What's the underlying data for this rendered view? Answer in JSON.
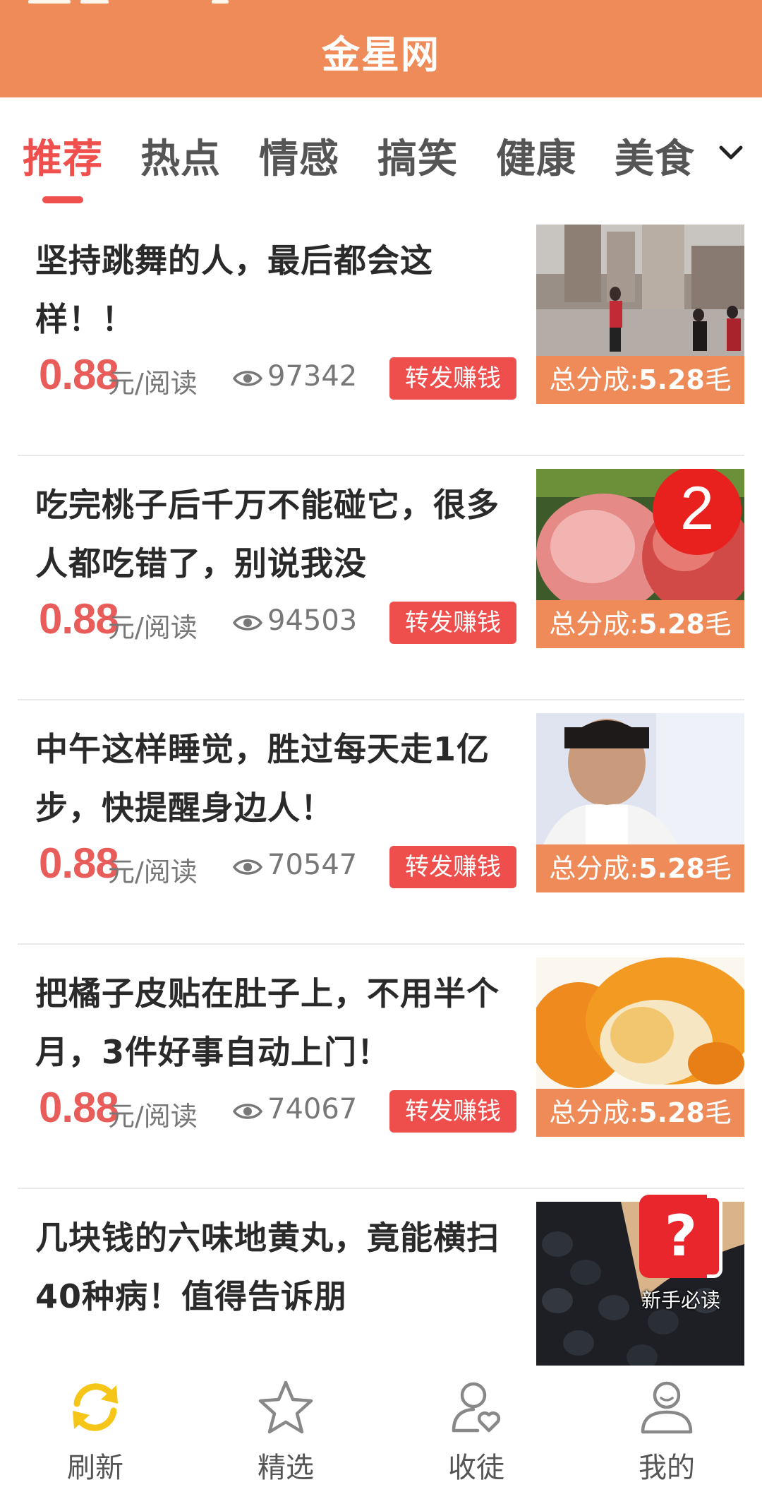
{
  "header": {
    "title": "金星网"
  },
  "tabs": {
    "items": [
      {
        "label": "推荐",
        "active": true
      },
      {
        "label": "热点",
        "active": false
      },
      {
        "label": "情感",
        "active": false
      },
      {
        "label": "搞笑",
        "active": false
      },
      {
        "label": "健康",
        "active": false
      },
      {
        "label": "美食",
        "active": false
      }
    ],
    "more_icon": "chevron-down-icon"
  },
  "articles": [
    {
      "title": "坚持跳舞的人，最后都会这样！！",
      "price": "0.88",
      "price_unit": "元/阅读",
      "views": "97342",
      "share_label": "转发赚钱",
      "badge_prefix": "总分成:",
      "badge_value": "5.28",
      "badge_unit": "毛"
    },
    {
      "title": "吃完桃子后千万不能碰它，很多人都吃错了，别说我没",
      "price": "0.88",
      "price_unit": "元/阅读",
      "views": "94503",
      "share_label": "转发赚钱",
      "badge_prefix": "总分成:",
      "badge_value": "5.28",
      "badge_unit": "毛",
      "image_number": "2"
    },
    {
      "title": "中午这样睡觉，胜过每天走1亿步，快提醒身边人！",
      "price": "0.88",
      "price_unit": "元/阅读",
      "views": "70547",
      "share_label": "转发赚钱",
      "badge_prefix": "总分成:",
      "badge_value": "5.28",
      "badge_unit": "毛"
    },
    {
      "title": "把橘子皮贴在肚子上，不用半个月，3件好事自动上门！",
      "price": "0.88",
      "price_unit": "元/阅读",
      "views": "74067",
      "share_label": "转发赚钱",
      "badge_prefix": "总分成:",
      "badge_value": "5.28",
      "badge_unit": "毛"
    },
    {
      "title": "几块钱的六味地黄丸，竟能横扫40种病！值得告诉朋"
    }
  ],
  "newbie": {
    "icon": "question-icon",
    "label": "新手必读"
  },
  "bottom_nav": [
    {
      "label": "刷新",
      "icon": "refresh-icon",
      "color": "#f5c518"
    },
    {
      "label": "精选",
      "icon": "star-icon"
    },
    {
      "label": "收徒",
      "icon": "disciple-icon"
    },
    {
      "label": "我的",
      "icon": "profile-icon"
    }
  ],
  "colors": {
    "brand": "#ee8b58",
    "accent_red": "#f0504d",
    "price_red": "#e85c5a",
    "refresh_yellow": "#f5c518"
  }
}
